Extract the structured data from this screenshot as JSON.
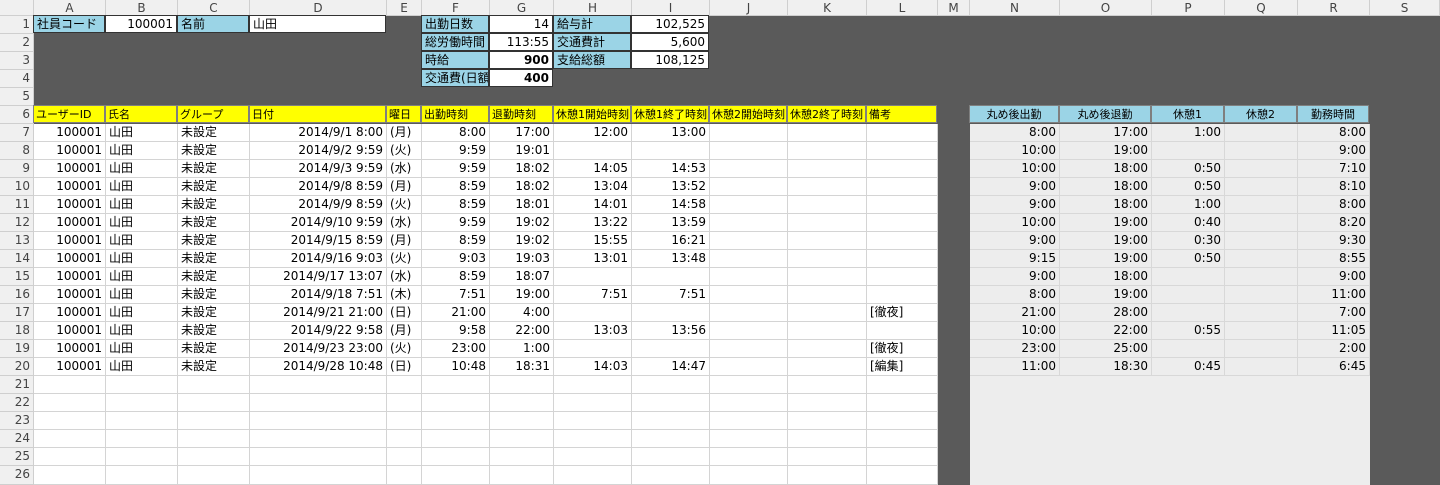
{
  "columns": [
    "A",
    "B",
    "C",
    "D",
    "E",
    "F",
    "G",
    "H",
    "I",
    "J",
    "K",
    "L",
    "M",
    "N",
    "O",
    "P",
    "Q",
    "R",
    "S"
  ],
  "rows": [
    "1",
    "2",
    "3",
    "4",
    "5",
    "6",
    "7",
    "8",
    "9",
    "10",
    "11",
    "12",
    "13",
    "14",
    "15",
    "16",
    "17",
    "18",
    "19",
    "20",
    "21",
    "22",
    "23",
    "24",
    "25",
    "26"
  ],
  "employee": {
    "code_label": "社員コード",
    "code_value": "100001",
    "name_label": "名前",
    "name_value": "山田"
  },
  "summary": {
    "left": [
      {
        "label": "出勤日数",
        "value": "14"
      },
      {
        "label": "総労働時間",
        "value": "113:55"
      },
      {
        "label": "時給",
        "value": "900"
      },
      {
        "label": "交通費(日額)",
        "value": "400"
      }
    ],
    "right": [
      {
        "label": "給与計",
        "value": "102,525"
      },
      {
        "label": "交通費計",
        "value": "5,600"
      },
      {
        "label": "支給総額",
        "value": "108,125"
      }
    ]
  },
  "table": {
    "headers": [
      "ユーザーID",
      "氏名",
      "グループ",
      "日付",
      "曜日",
      "出勤時刻",
      "退勤時刻",
      "休憩1開始時刻",
      "休憩1終了時刻",
      "休憩2開始時刻",
      "休憩2終了時刻",
      "備考"
    ],
    "rows": [
      [
        "100001",
        "山田",
        "未設定",
        "2014/9/1 8:00",
        "(月)",
        "8:00",
        "17:00",
        "12:00",
        "13:00",
        "",
        "",
        ""
      ],
      [
        "100001",
        "山田",
        "未設定",
        "2014/9/2 9:59",
        "(火)",
        "9:59",
        "19:01",
        "",
        "",
        "",
        "",
        ""
      ],
      [
        "100001",
        "山田",
        "未設定",
        "2014/9/3 9:59",
        "(水)",
        "9:59",
        "18:02",
        "14:05",
        "14:53",
        "",
        "",
        ""
      ],
      [
        "100001",
        "山田",
        "未設定",
        "2014/9/8 8:59",
        "(月)",
        "8:59",
        "18:02",
        "13:04",
        "13:52",
        "",
        "",
        ""
      ],
      [
        "100001",
        "山田",
        "未設定",
        "2014/9/9 8:59",
        "(火)",
        "8:59",
        "18:01",
        "14:01",
        "14:58",
        "",
        "",
        ""
      ],
      [
        "100001",
        "山田",
        "未設定",
        "2014/9/10 9:59",
        "(水)",
        "9:59",
        "19:02",
        "13:22",
        "13:59",
        "",
        "",
        ""
      ],
      [
        "100001",
        "山田",
        "未設定",
        "2014/9/15 8:59",
        "(月)",
        "8:59",
        "19:02",
        "15:55",
        "16:21",
        "",
        "",
        ""
      ],
      [
        "100001",
        "山田",
        "未設定",
        "2014/9/16 9:03",
        "(火)",
        "9:03",
        "19:03",
        "13:01",
        "13:48",
        "",
        "",
        ""
      ],
      [
        "100001",
        "山田",
        "未設定",
        "2014/9/17 13:07",
        "(水)",
        "8:59",
        "18:07",
        "",
        "",
        "",
        "",
        ""
      ],
      [
        "100001",
        "山田",
        "未設定",
        "2014/9/18 7:51",
        "(木)",
        "7:51",
        "19:00",
        "7:51",
        "7:51",
        "",
        "",
        ""
      ],
      [
        "100001",
        "山田",
        "未設定",
        "2014/9/21 21:00",
        "(日)",
        "21:00",
        "4:00",
        "",
        "",
        "",
        "",
        "[徹夜]"
      ],
      [
        "100001",
        "山田",
        "未設定",
        "2014/9/22 9:58",
        "(月)",
        "9:58",
        "22:00",
        "13:03",
        "13:56",
        "",
        "",
        ""
      ],
      [
        "100001",
        "山田",
        "未設定",
        "2014/9/23 23:00",
        "(火)",
        "23:00",
        "1:00",
        "",
        "",
        "",
        "",
        "[徹夜]"
      ],
      [
        "100001",
        "山田",
        "未設定",
        "2014/9/28 10:48",
        "(日)",
        "10:48",
        "18:31",
        "14:03",
        "14:47",
        "",
        "",
        "[編集]"
      ]
    ]
  },
  "rounded": {
    "headers": [
      "丸め後出勤",
      "丸め後退勤",
      "休憩1",
      "休憩2",
      "勤務時間"
    ],
    "rows": [
      [
        "8:00",
        "17:00",
        "1:00",
        "",
        "8:00"
      ],
      [
        "10:00",
        "19:00",
        "",
        "",
        "9:00"
      ],
      [
        "10:00",
        "18:00",
        "0:50",
        "",
        "7:10"
      ],
      [
        "9:00",
        "18:00",
        "0:50",
        "",
        "8:10"
      ],
      [
        "9:00",
        "18:00",
        "1:00",
        "",
        "8:00"
      ],
      [
        "10:00",
        "19:00",
        "0:40",
        "",
        "8:20"
      ],
      [
        "9:00",
        "19:00",
        "0:30",
        "",
        "9:30"
      ],
      [
        "9:15",
        "19:00",
        "0:50",
        "",
        "8:55"
      ],
      [
        "9:00",
        "18:00",
        "",
        "",
        "9:00"
      ],
      [
        "8:00",
        "19:00",
        "",
        "",
        "11:00"
      ],
      [
        "21:00",
        "28:00",
        "",
        "",
        "7:00"
      ],
      [
        "10:00",
        "22:00",
        "0:55",
        "",
        "11:05"
      ],
      [
        "23:00",
        "25:00",
        "",
        "",
        "2:00"
      ],
      [
        "11:00",
        "18:30",
        "0:45",
        "",
        "6:45"
      ]
    ]
  },
  "colors": {
    "header_yellow": "#ffff00",
    "header_blue": "#9bd4e6",
    "sheet_bg": "#5a5a5a",
    "rounded_bg": "#ededed"
  }
}
